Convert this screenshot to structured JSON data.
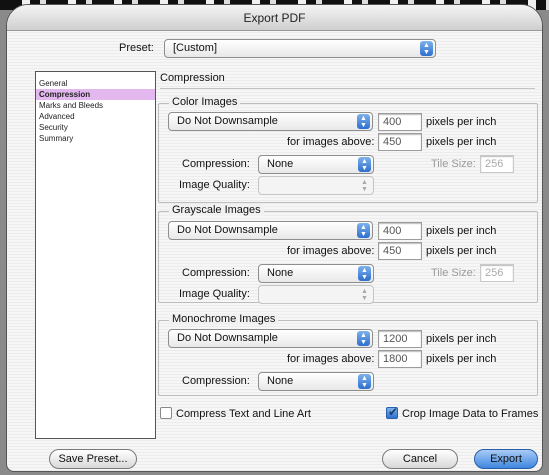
{
  "window": {
    "title": "Export PDF"
  },
  "preset": {
    "label": "Preset:",
    "value": "[Custom]"
  },
  "sidebar": {
    "items": [
      {
        "label": "General"
      },
      {
        "label": "Compression"
      },
      {
        "label": "Marks and Bleeds"
      },
      {
        "label": "Advanced"
      },
      {
        "label": "Security"
      },
      {
        "label": "Summary"
      }
    ]
  },
  "panel": {
    "title": "Compression"
  },
  "color_images": {
    "title": "Color Images",
    "downsample": "Do Not Downsample",
    "ppi_value": "400",
    "ppi_unit": "pixels per inch",
    "above_label": "for images above:",
    "above_value": "450",
    "above_unit": "pixels per inch",
    "compression_label": "Compression:",
    "compression_value": "None",
    "tile_label": "Tile Size:",
    "tile_value": "256",
    "quality_label": "Image Quality:",
    "quality_value": ""
  },
  "grayscale_images": {
    "title": "Grayscale Images",
    "downsample": "Do Not Downsample",
    "ppi_value": "400",
    "ppi_unit": "pixels per inch",
    "above_label": "for images above:",
    "above_value": "450",
    "above_unit": "pixels per inch",
    "compression_label": "Compression:",
    "compression_value": "None",
    "tile_label": "Tile Size:",
    "tile_value": "256",
    "quality_label": "Image Quality:",
    "quality_value": ""
  },
  "monochrome_images": {
    "title": "Monochrome Images",
    "downsample": "Do Not Downsample",
    "ppi_value": "1200",
    "ppi_unit": "pixels per inch",
    "above_label": "for images above:",
    "above_value": "1800",
    "above_unit": "pixels per inch",
    "compression_label": "Compression:",
    "compression_value": "None"
  },
  "options": {
    "compress_text_label": "Compress Text and Line Art",
    "compress_text_checked": false,
    "crop_label": "Crop Image Data to Frames",
    "crop_checked": true
  },
  "buttons": {
    "save_preset": "Save Preset...",
    "cancel": "Cancel",
    "export": "Export"
  },
  "colors": {
    "accent": "#3f86e0",
    "selection": "#e2b8ee"
  }
}
